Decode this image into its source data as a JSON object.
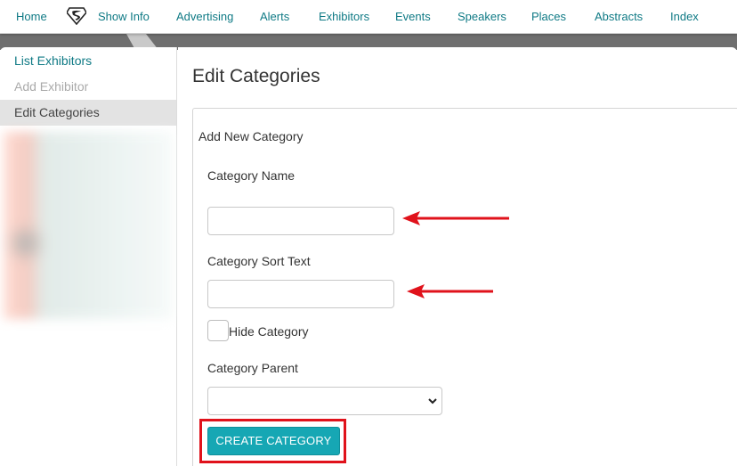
{
  "nav": {
    "items": [
      "Home",
      "Show Info",
      "Advertising",
      "Alerts",
      "Exhibitors",
      "Events",
      "Speakers",
      "Places",
      "Abstracts",
      "Index"
    ],
    "logo_icon": "superman-shield-icon"
  },
  "sidebar": {
    "items": [
      {
        "label": "List Exhibitors",
        "state": "link"
      },
      {
        "label": "Add Exhibitor",
        "state": "disabled"
      },
      {
        "label": "Edit Categories",
        "state": "active"
      }
    ]
  },
  "main": {
    "title": "Edit Categories",
    "panel_heading": "Add New Category",
    "fields": {
      "category_name_label": "Category Name",
      "category_name_value": "",
      "category_sort_label": "Category Sort Text",
      "category_sort_value": "",
      "hide_category_label": "Hide Category",
      "hide_category_checked": false,
      "category_parent_label": "Category Parent",
      "category_parent_value": ""
    },
    "create_button": "CREATE CATEGORY"
  },
  "colors": {
    "link": "#0f7a85",
    "button": "#16a7b4",
    "annotation": "#e0121b",
    "active_bg": "#e3e3e3"
  }
}
